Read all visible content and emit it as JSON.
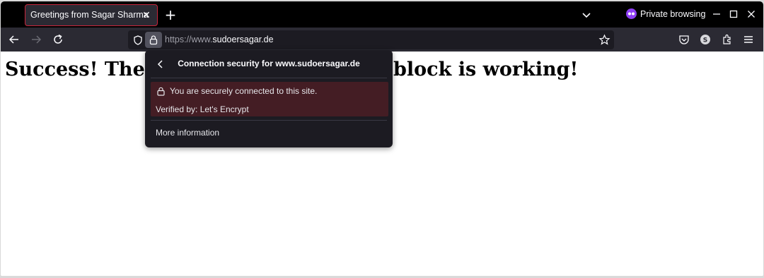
{
  "colors": {
    "tabstrip_bg": "#000000",
    "toolbar_bg": "#2b2a33",
    "urlbar_bg": "#1c1b22",
    "active_tab_border": "#c9253b",
    "private_accent": "#8f3ff6",
    "panel_bg": "#1c1b22",
    "secure_box_bg": "#441d24"
  },
  "tab": {
    "title": "Greetings from Sagar Sharma",
    "close_icon": "close-icon"
  },
  "tabstrip": {
    "new_tab_label": "+",
    "list_tabs_icon": "chevron-down-icon",
    "private_label": "Private browsing",
    "private_icon": "mask-icon"
  },
  "window_controls": [
    "minimize-icon",
    "maximize-icon",
    "close-icon"
  ],
  "navbar": {
    "back_icon": "arrow-left-icon",
    "forward_icon": "arrow-right-icon",
    "reload_icon": "reload-icon",
    "url_scheme": "https://www.",
    "url_host": "sudoersagar.de",
    "right_icons": [
      "pocket-icon",
      "account-icon",
      "extensions-icon",
      "menu-icon"
    ],
    "account_initial": "S"
  },
  "page": {
    "heading": "Success! The sudoersagar.de server block is working!"
  },
  "popup": {
    "title": "Connection security for www.sudoersagar.de",
    "secure_text": "You are securely connected to this site.",
    "verified_text": "Verified by: Let's Encrypt",
    "more_info": "More information"
  }
}
